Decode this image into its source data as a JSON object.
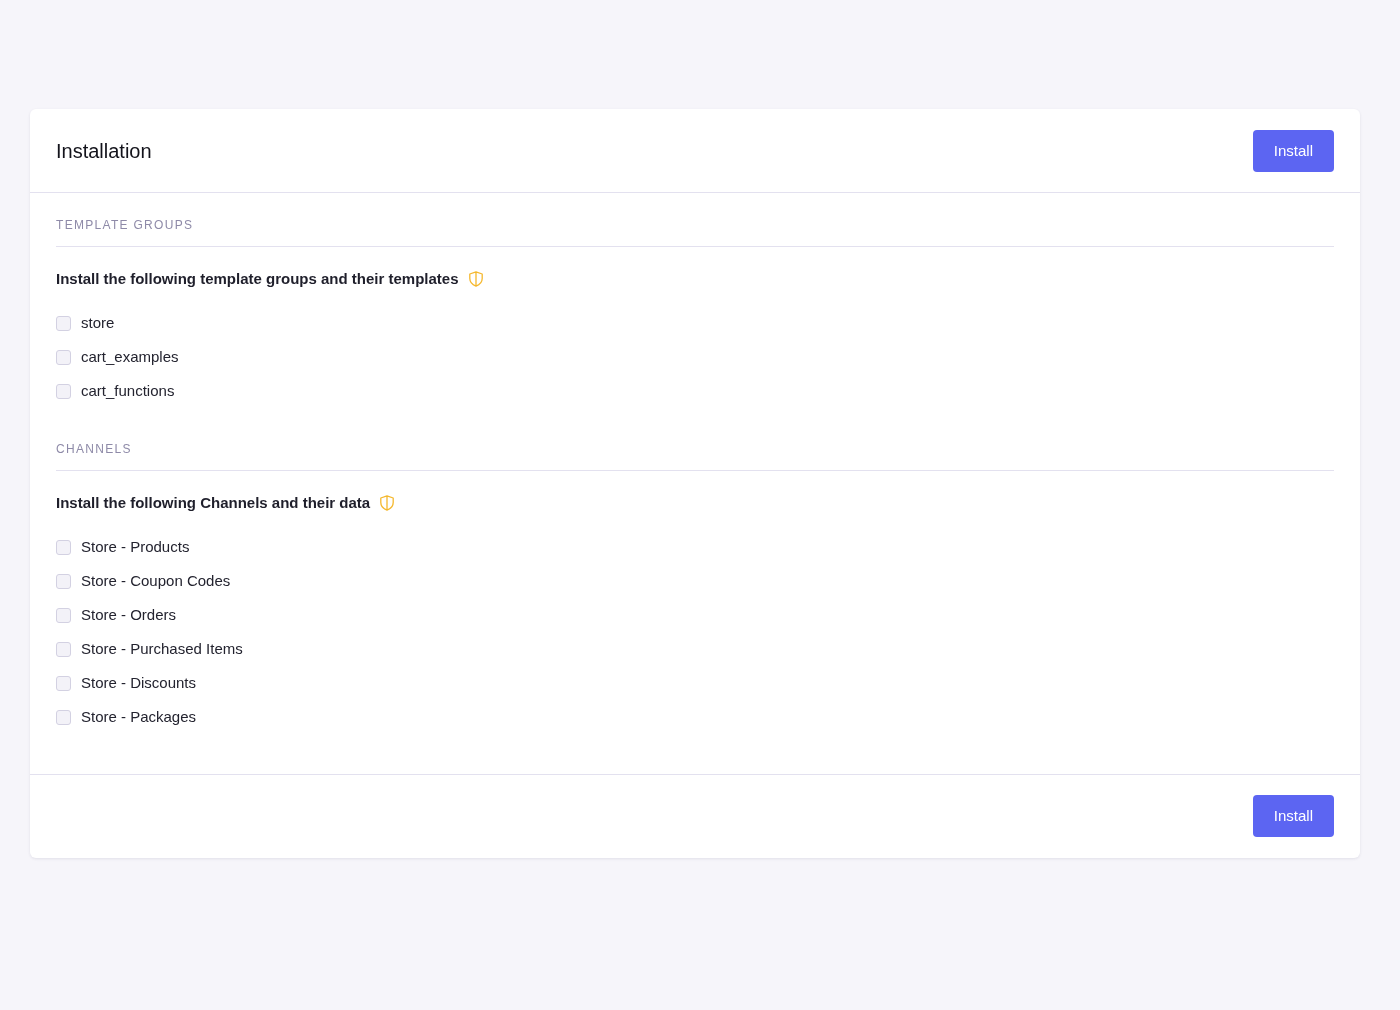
{
  "header": {
    "title": "Installation",
    "button": "Install"
  },
  "sections": [
    {
      "heading": "TEMPLATE GROUPS",
      "description": "Install the following template groups and their templates",
      "items": [
        {
          "label": "store",
          "checked": false
        },
        {
          "label": "cart_examples",
          "checked": false
        },
        {
          "label": "cart_functions",
          "checked": false
        }
      ]
    },
    {
      "heading": "CHANNELS",
      "description": "Install the following Channels and their data",
      "items": [
        {
          "label": "Store - Products",
          "checked": false
        },
        {
          "label": "Store - Coupon Codes",
          "checked": false
        },
        {
          "label": "Store - Orders",
          "checked": false
        },
        {
          "label": "Store - Purchased Items",
          "checked": false
        },
        {
          "label": "Store - Discounts",
          "checked": false
        },
        {
          "label": "Store - Packages",
          "checked": false
        }
      ]
    }
  ],
  "footer": {
    "button": "Install"
  }
}
